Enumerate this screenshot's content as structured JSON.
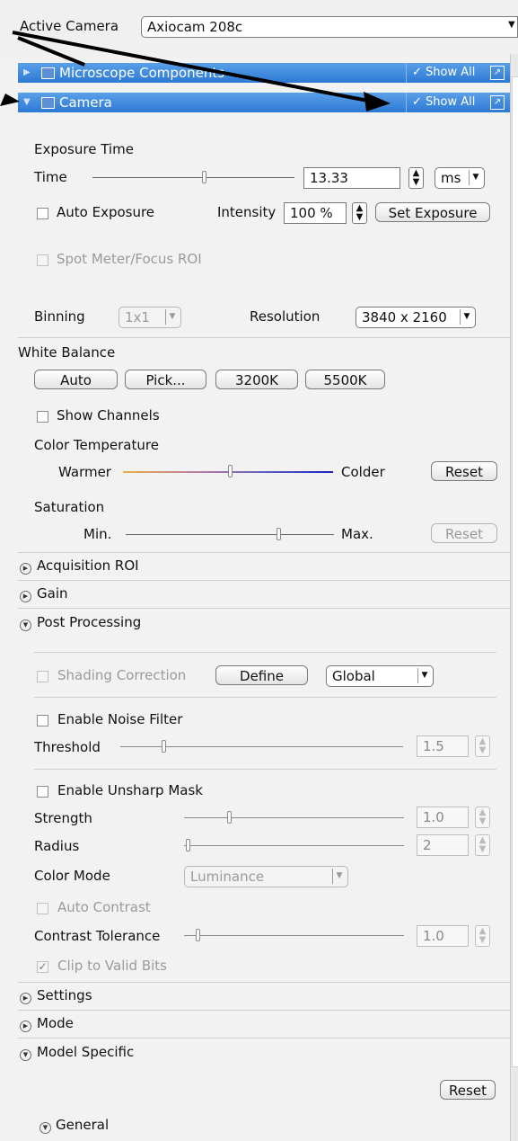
{
  "top": {
    "label": "Active Camera",
    "camera": "Axiocam 208c"
  },
  "headers": {
    "microscope": {
      "title": "Microscope Components",
      "show_all": "✓ Show All"
    },
    "camera": {
      "title": "Camera",
      "show_all": "✓ Show All"
    }
  },
  "exposure": {
    "section": "Exposure Time",
    "time_label": "Time",
    "time_value": "13.33",
    "unit": "ms",
    "auto_exposure": "Auto Exposure",
    "intensity_label": "Intensity",
    "intensity_value": "100 %",
    "set_exposure": "Set Exposure",
    "spot_meter": "Spot Meter/Focus ROI"
  },
  "binning": {
    "label": "Binning",
    "value": "1x1",
    "resolution_label": "Resolution",
    "resolution_value": "3840 x 2160"
  },
  "white_balance": {
    "section": "White Balance",
    "buttons": [
      "Auto",
      "Pick...",
      "3200K",
      "5500K"
    ],
    "show_channels": "Show Channels",
    "color_temp": "Color Temperature",
    "warmer": "Warmer",
    "colder": "Colder",
    "reset": "Reset",
    "saturation": "Saturation",
    "min": "Min.",
    "max": "Max.",
    "reset2": "Reset"
  },
  "groups": {
    "acquisition_roi": "Acquisition ROI",
    "gain": "Gain",
    "post_processing": "Post Processing",
    "settings": "Settings",
    "mode": "Mode",
    "model_specific": "Model Specific",
    "general": "General"
  },
  "post": {
    "shading": "Shading Correction",
    "define": "Define",
    "global": "Global",
    "noise_filter": "Enable Noise Filter",
    "threshold_label": "Threshold",
    "threshold_value": "1.5",
    "unsharp": "Enable Unsharp Mask",
    "strength_label": "Strength",
    "strength_value": "1.0",
    "radius_label": "Radius",
    "radius_value": "2",
    "color_mode_label": "Color Mode",
    "color_mode_value": "Luminance",
    "auto_contrast": "Auto Contrast",
    "contrast_tol_label": "Contrast Tolerance",
    "contrast_tol_value": "1.0",
    "clip": "Clip to Valid Bits"
  },
  "model_reset": "Reset",
  "icons": [
    "expand-icon",
    "collapse-icon",
    "popout-icon",
    "checkmark-icon",
    "spinner-icon",
    "dropdown-arrow-icon"
  ]
}
